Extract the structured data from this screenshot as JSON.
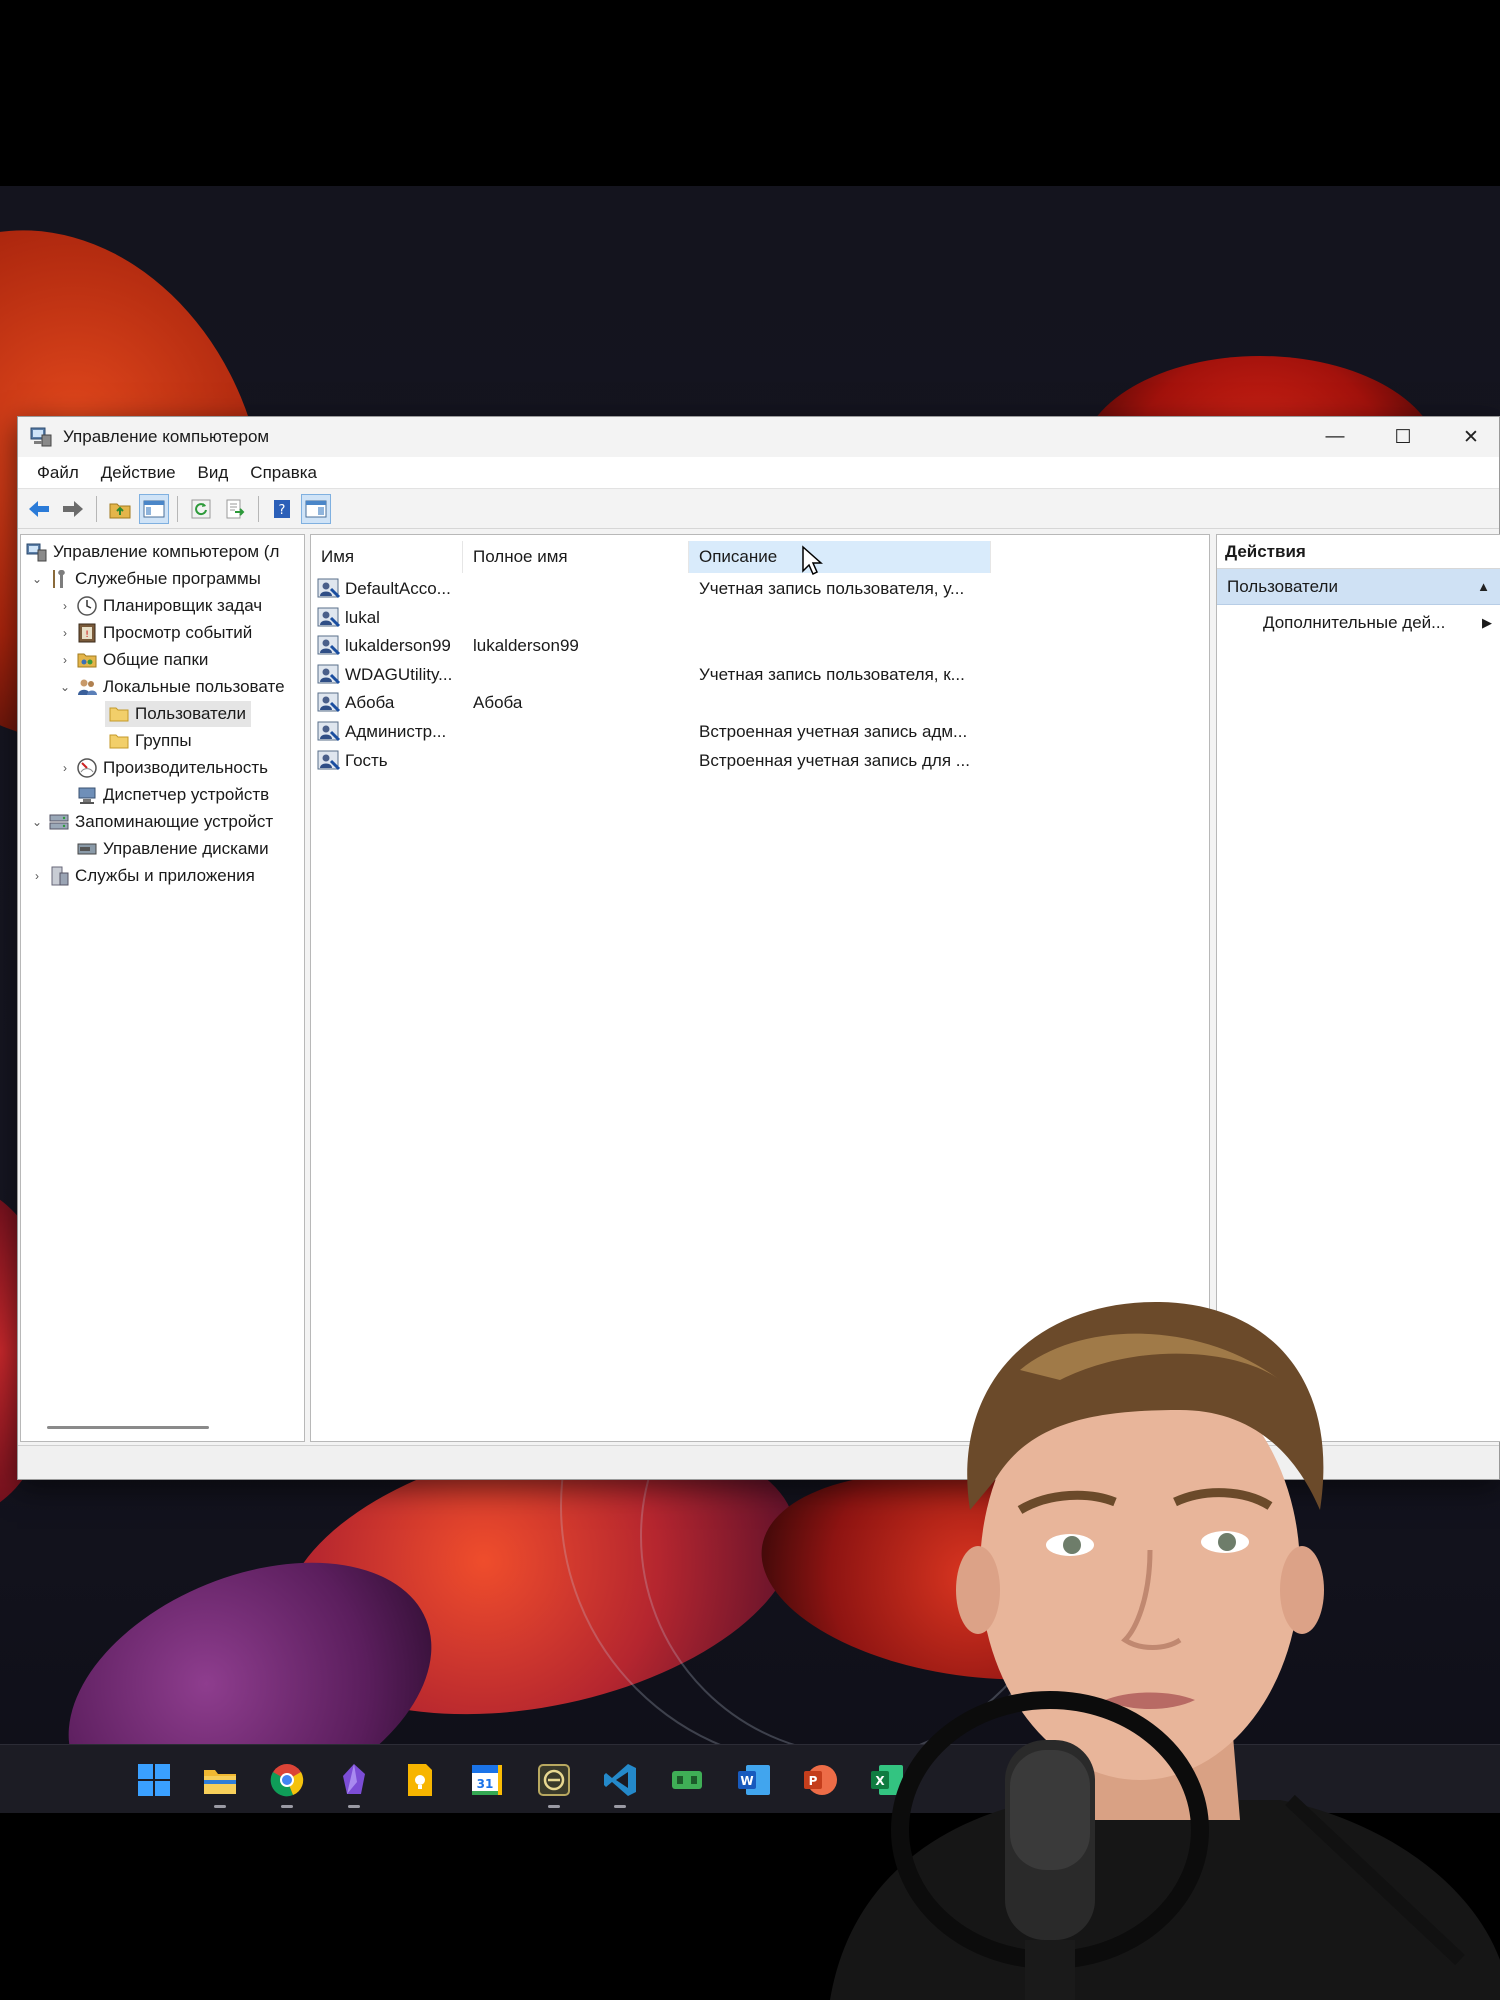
{
  "window": {
    "title": "Управление компьютером",
    "controls": {
      "minimize": "—",
      "maximize": "☐",
      "close": "✕"
    }
  },
  "menu": {
    "file": "Файл",
    "action": "Действие",
    "view": "Вид",
    "help": "Справка"
  },
  "tree": {
    "root": "Управление компьютером (л",
    "system_tools": "Служебные программы",
    "task_scheduler": "Планировщик задач",
    "event_viewer": "Просмотр событий",
    "shared_folders": "Общие папки",
    "local_users": "Локальные пользовате",
    "users": "Пользователи",
    "groups": "Группы",
    "performance": "Производительность",
    "device_manager": "Диспетчер устройств",
    "storage": "Запоминающие устройст",
    "disk_management": "Управление дисками",
    "services_apps": "Службы и приложения"
  },
  "list": {
    "columns": {
      "name": "Имя",
      "full_name": "Полное имя",
      "description": "Описание"
    },
    "rows": [
      {
        "name": "DefaultAcco...",
        "full_name": "",
        "description": "Учетная запись пользователя, у..."
      },
      {
        "name": "lukal",
        "full_name": "",
        "description": ""
      },
      {
        "name": "lukalderson99",
        "full_name": "lukalderson99",
        "description": ""
      },
      {
        "name": "WDAGUtility...",
        "full_name": "",
        "description": "Учетная запись пользователя, к..."
      },
      {
        "name": "Абоба",
        "full_name": "Абоба",
        "description": ""
      },
      {
        "name": "Администр...",
        "full_name": "",
        "description": "Встроенная учетная запись адм..."
      },
      {
        "name": "Гость",
        "full_name": "",
        "description": "Встроенная учетная запись для ..."
      }
    ]
  },
  "actions": {
    "title": "Действия",
    "section": "Пользователи",
    "more": "Дополнительные дей..."
  },
  "taskbar": {
    "apps": [
      "start-icon",
      "file-explorer-icon",
      "chrome-icon",
      "obsidian-icon",
      "keep-icon",
      "calendar-icon",
      "cursor-app-icon",
      "vscode-icon",
      "game-icon",
      "word-icon",
      "powerpoint-icon",
      "excel-icon"
    ],
    "calendar_day": "31"
  },
  "colors": {
    "selection": "#cfe1f4",
    "header_hover": "#d9ebfb",
    "taskbar": "#1c1c24"
  }
}
